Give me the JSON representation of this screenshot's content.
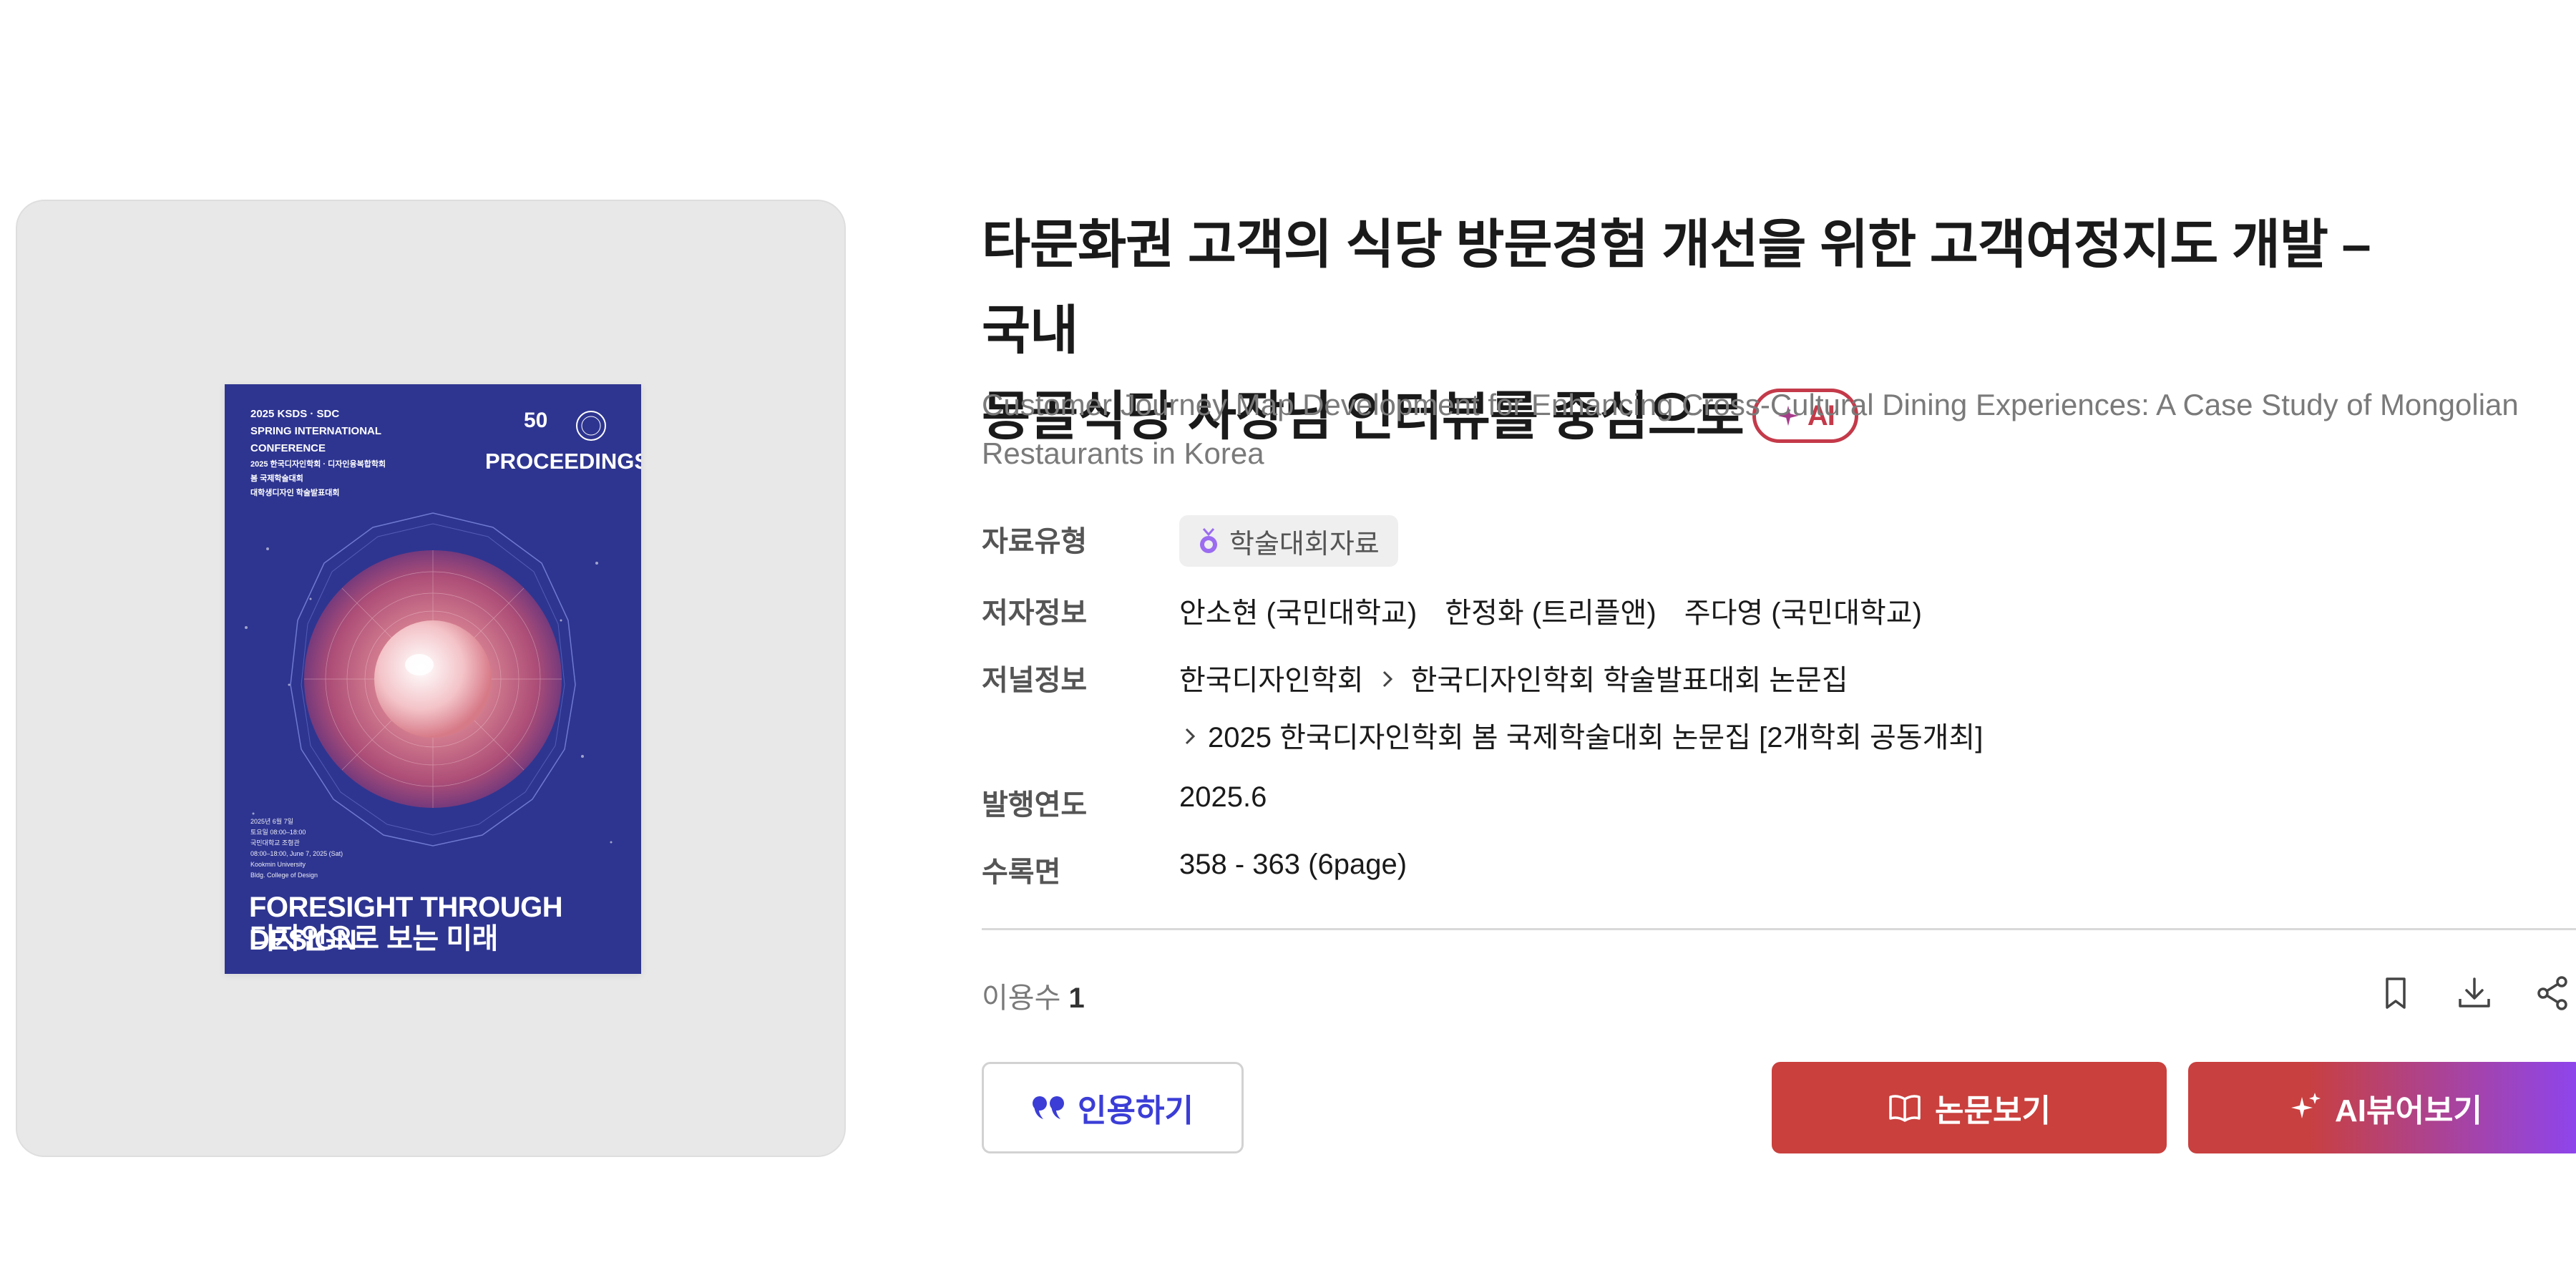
{
  "paper": {
    "title_line1": "타문화권 고객의 식당 방문경험 개선을 위한 고객여정지도 개발 – 국내",
    "title_line2": "몽골식당 사장님 인터뷰를 중심으로",
    "ai_badge": "AI",
    "subtitle": "Customer Journey Map Development for Enhancing Cross-Cultural Dining Experiences: A Case Study of Mongolian Restaurants in Korea"
  },
  "cover": {
    "line1": "2025 KSDS · SDC",
    "line2": "SPRING INTERNATIONAL",
    "line3": "CONFERENCE",
    "line4": "2025 한국디자인학회 · 디자인융복합학회",
    "line5": "봄 국제학술대회",
    "line6": "대학생디자인 학술발표대회",
    "proceedings": "PROCEEDINGS",
    "date1": "2025년 6월 7일",
    "date2": "토요일 08:00–18:00",
    "date3": "국민대학교 조형관",
    "date4": "08:00–18:00, June 7, 2025 (Sat)",
    "date5": "Kookmin University",
    "date6": "Bldg. College of Design",
    "foresight": "FORESIGHT THROUGH DESIGN",
    "foresight_kr": "디자인으로 보는 미래",
    "logo_number": "50"
  },
  "meta": {
    "type_label": "자료유형",
    "type_value": "학술대회자료",
    "author_label": "저자정보",
    "authors": [
      "안소현 (국민대학교)",
      "한정화 (트리플앤)",
      "주다영 (국민대학교)"
    ],
    "journal_label": "저널정보",
    "journal_publisher": "한국디자인학회",
    "journal_series": "한국디자인학회 학술발표대회 논문집",
    "journal_issue": "2025 한국디자인학회 봄 국제학술대회 논문집 [2개학회 공동개최]",
    "year_label": "발행연도",
    "year_value": "2025.6",
    "pages_label": "수록면",
    "pages_value": "358 - 363 (6page)"
  },
  "usage": {
    "label": "이용수",
    "count": "1"
  },
  "buttons": {
    "cite": "인용하기",
    "view": "논문보기",
    "ai_view": "AI뷰어보기"
  },
  "icons": [
    "bookmark-icon",
    "download-icon",
    "share-icon",
    "quote-icon",
    "book-icon",
    "sparkle-icon",
    "medal-icon",
    "chevron-right-icon"
  ],
  "colors": {
    "accent_red": "#c9403d",
    "accent_purple": "#8c45f0",
    "cite_blue": "#3b3dd6",
    "cover_blue": "#2e3590"
  }
}
